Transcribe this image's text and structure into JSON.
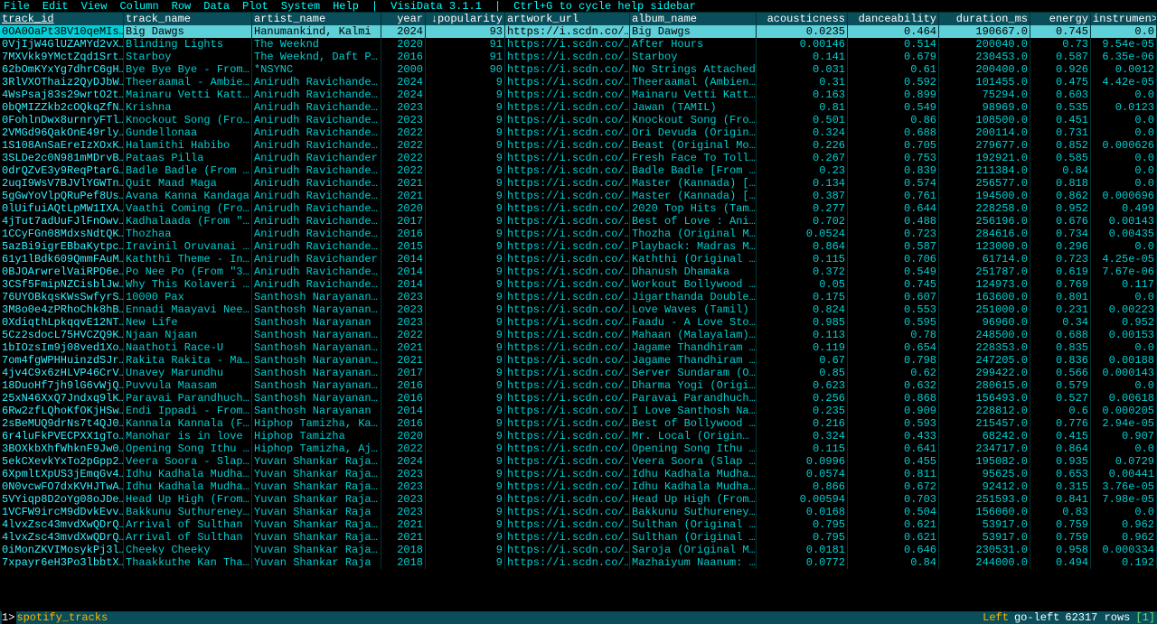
{
  "menu": [
    "File",
    "Edit",
    "View",
    "Column",
    "Row",
    "Data",
    "Plot",
    "System",
    "Help"
  ],
  "menuInfo1": "VisiData 3.1.1",
  "menuInfo2": "Ctrl+G to cycle help sidebar",
  "columns": [
    {
      "label": "track_id",
      "align": "left",
      "key": true
    },
    {
      "label": "track_name",
      "align": "left"
    },
    {
      "label": "artist_name",
      "align": "left"
    },
    {
      "label": "year",
      "align": "right"
    },
    {
      "label": "↓popularity",
      "align": "right"
    },
    {
      "label": "artwork_url",
      "align": "left"
    },
    {
      "label": "album_name",
      "align": "left"
    },
    {
      "label": "acousticness",
      "align": "right"
    },
    {
      "label": "danceability",
      "align": "right"
    },
    {
      "label": "duration_ms",
      "align": "right"
    },
    {
      "label": "energy",
      "align": "right"
    },
    {
      "label": "instrumen>",
      "align": "right"
    }
  ],
  "rows": [
    [
      "0OA0OaPt3BV10qeMIs…",
      "Big Dawgs",
      "Hanumankind, Kalmi",
      "2024",
      "93",
      "https://i.scdn.co/…",
      "Big Dawgs",
      "0.0235",
      "0.464",
      "190667.0",
      "0.745",
      "0.0"
    ],
    [
      "0VjIjW4GlUZAMYd2vX…",
      "Blinding Lights",
      "The Weeknd",
      "2020",
      "91",
      "https://i.scdn.co/…",
      "After Hours",
      "0.00146",
      "0.514",
      "200040.0",
      "0.73",
      "9.54e-05"
    ],
    [
      "7MXVkk9YMctZqd1Srt…",
      "Starboy",
      "The Weeknd, Daft P…",
      "2016",
      "91",
      "https://i.scdn.co/…",
      "Starboy",
      "0.141",
      "0.679",
      "230453.0",
      "0.587",
      "6.35e-06"
    ],
    [
      "62bOmKYxYg7dhrC6gH…",
      "Bye Bye Bye - From…",
      "*NSYNC",
      "2000",
      "90",
      "https://i.scdn.co/…",
      "No Strings Attached",
      "0.031",
      "0.61",
      "200400.0",
      "0.926",
      "0.0012"
    ],
    [
      "3RlVXOThaiz2QyDJbW…",
      "Theeraamal - Ambie…",
      "Anirudh Ravichande…",
      "2024",
      "9",
      "https://i.scdn.co/…",
      "Theeraamal (Ambien…",
      "0.31",
      "0.592",
      "101455.0",
      "0.475",
      "4.42e-05"
    ],
    [
      "4WsPsaj83s29wrtO2t…",
      "Mainaru Vetti Katt…",
      "Anirudh Ravichande…",
      "2024",
      "9",
      "https://i.scdn.co/…",
      "Mainaru Vetti Katt…",
      "0.163",
      "0.899",
      "75294.0",
      "0.603",
      "0.0"
    ],
    [
      "0bQMIZZkb2cOQkqZfN…",
      "Krishna",
      "Anirudh Ravichande…",
      "2023",
      "9",
      "https://i.scdn.co/…",
      "Jawan (TAMIL)",
      "0.81",
      "0.549",
      "98969.0",
      "0.535",
      "0.0123"
    ],
    [
      "0FohlnDwx8urnryFTl…",
      "Knockout Song (Fro…",
      "Anirudh Ravichande…",
      "2023",
      "9",
      "https://i.scdn.co/…",
      "Knockout Song (Fro…",
      "0.501",
      "0.86",
      "108500.0",
      "0.451",
      "0.0"
    ],
    [
      "2VMGd96QakOnE49rly…",
      "Gundellonaa",
      "Anirudh Ravichande…",
      "2022",
      "9",
      "https://i.scdn.co/…",
      "Ori Devuda (Origin…",
      "0.324",
      "0.688",
      "200114.0",
      "0.731",
      "0.0"
    ],
    [
      "1S108AnSaEreIzXOxK…",
      "Halamithi Habibo",
      "Anirudh Ravichande…",
      "2022",
      "9",
      "https://i.scdn.co/…",
      "Beast (Original Mo…",
      "0.226",
      "0.705",
      "279677.0",
      "0.852",
      "0.000626"
    ],
    [
      "3SLDe2c0N981mMDrvB…",
      "Pataas Pilla",
      "Anirudh Ravichander",
      "2022",
      "9",
      "https://i.scdn.co/…",
      "Fresh Face To Toll…",
      "0.267",
      "0.753",
      "192921.0",
      "0.585",
      "0.0"
    ],
    [
      "0drQZvE3y9ReqPtarG…",
      "Badle Badle (From …",
      "Anirudh Ravichande…",
      "2022",
      "9",
      "https://i.scdn.co/…",
      "Badle Badle [From …",
      "0.23",
      "0.839",
      "211384.0",
      "0.84",
      "0.0"
    ],
    [
      "2uqI9WsV7BJVlYGWTn…",
      "Quit Maad Maga",
      "Anirudh Ravichande…",
      "2021",
      "9",
      "https://i.scdn.co/…",
      "Master (Kannada) […",
      "0.134",
      "0.574",
      "256577.0",
      "0.818",
      "0.0"
    ],
    [
      "5gGwYoVlpQRuPef8Us…",
      "Avana Kanna Kandaga",
      "Anirudh Ravichande…",
      "2021",
      "9",
      "https://i.scdn.co/…",
      "Master (Kannada) […",
      "0.387",
      "0.761",
      "194500.0",
      "0.862",
      "0.000696"
    ],
    [
      "0lUifuiAQtLpMW1IXA…",
      "Vaathi Coming (Fro…",
      "Anirudh Ravichande…",
      "2020",
      "9",
      "https://i.scdn.co/…",
      "2020 Top Hits (Tam…",
      "0.277",
      "0.644",
      "228258.0",
      "0.952",
      "0.499"
    ],
    [
      "4jTut7adUuFJlFnOwv…",
      "Kadhalaada (From \"…",
      "Anirudh Ravichande…",
      "2017",
      "9",
      "https://i.scdn.co/…",
      "Best of Love : Ani…",
      "0.702",
      "0.488",
      "256196.0",
      "0.676",
      "0.00143"
    ],
    [
      "1CCyFGn08MdxsNdtQK…",
      "Thozhaa",
      "Anirudh Ravichande…",
      "2016",
      "9",
      "https://i.scdn.co/…",
      "Thozha (Original M…",
      "0.0524",
      "0.723",
      "284616.0",
      "0.734",
      "0.00435"
    ],
    [
      "5azBi9igrEBbaKytpc…",
      "Iravinil Oruvanai …",
      "Anirudh Ravichande…",
      "2015",
      "9",
      "https://i.scdn.co/…",
      "Playback: Madras M…",
      "0.864",
      "0.587",
      "123000.0",
      "0.296",
      "0.0"
    ],
    [
      "61y1lBdk609QmmFAuM…",
      "Kaththi Theme - In…",
      "Anirudh Ravichander",
      "2014",
      "9",
      "https://i.scdn.co/…",
      "Kaththi (Original …",
      "0.115",
      "0.706",
      "61714.0",
      "0.723",
      "4.25e-05"
    ],
    [
      "0BJOArwrelVaiRPD6e…",
      "Po Nee Po (From \"3…",
      "Anirudh Ravichande…",
      "2014",
      "9",
      "https://i.scdn.co/…",
      "Dhanush Dhamaka",
      "0.372",
      "0.549",
      "251787.0",
      "0.619",
      "7.67e-06"
    ],
    [
      "3CSf5FmipNZCisblJw…",
      "Why This Kolaveri …",
      "Anirudh Ravichande…",
      "2014",
      "9",
      "https://i.scdn.co/…",
      "Workout Bollywood …",
      "0.05",
      "0.745",
      "124973.0",
      "0.769",
      "0.117"
    ],
    [
      "76UYOBkqsKWsSwfyrS…",
      "10000 Pax",
      "Santhosh Narayanan…",
      "2023",
      "9",
      "https://i.scdn.co/…",
      "Jigarthanda Double…",
      "0.175",
      "0.607",
      "163600.0",
      "0.801",
      "0.0"
    ],
    [
      "3M8o0e4zPRhoChk8hB…",
      "Ennadi Maayavi Nee…",
      "Santhosh Narayanan…",
      "2023",
      "9",
      "https://i.scdn.co/…",
      "Love Waves (Tamil)",
      "0.824",
      "0.553",
      "251000.0",
      "0.231",
      "0.00223"
    ],
    [
      "0XdiqthLpkqqvE12NT…",
      "New Life",
      "Santhosh Narayanan",
      "2023",
      "9",
      "https://i.scdn.co/…",
      "Faadu - A Love Sto…",
      "0.985",
      "0.595",
      "96960.0",
      "0.34",
      "0.952"
    ],
    [
      "5Cz2sdocL75HVCZQ9K…",
      "Njaan Njaan",
      "Santhosh Narayanan…",
      "2022",
      "9",
      "https://i.scdn.co/…",
      "Mahaan (Malayalam)…",
      "0.113",
      "0.78",
      "248500.0",
      "0.688",
      "0.00153"
    ],
    [
      "1bIOzsIm9j08ved1Xo…",
      "Naathoti Race-U",
      "Santhosh Narayanan…",
      "2021",
      "9",
      "https://i.scdn.co/…",
      "Jagame Thandhiram …",
      "0.119",
      "0.654",
      "228353.0",
      "0.835",
      "0.0"
    ],
    [
      "7om4fgWPHHuinzdSJr…",
      "Rakita Rakita - Ma…",
      "Santhosh Narayanan…",
      "2021",
      "9",
      "https://i.scdn.co/…",
      "Jagame Thandhiram …",
      "0.67",
      "0.798",
      "247205.0",
      "0.836",
      "0.00188"
    ],
    [
      "4jv4C9x6zHLVP46CrV…",
      "Unavey Marundhu",
      "Santhosh Narayanan…",
      "2017",
      "9",
      "https://i.scdn.co/…",
      "Server Sundaram (O…",
      "0.85",
      "0.62",
      "299422.0",
      "0.566",
      "0.000143"
    ],
    [
      "18DuoHf7jh9lG6vWjQ…",
      "Puvvula Maasam",
      "Santhosh Narayanan…",
      "2016",
      "9",
      "https://i.scdn.co/…",
      "Dharma Yogi (Origi…",
      "0.623",
      "0.632",
      "280615.0",
      "0.579",
      "0.0"
    ],
    [
      "25xN46XxQ7Jndxq9lK…",
      "Paravai Parandhuch…",
      "Santhosh Narayanan…",
      "2016",
      "9",
      "https://i.scdn.co/…",
      "Paravai Parandhuch…",
      "0.256",
      "0.868",
      "156493.0",
      "0.527",
      "0.00618"
    ],
    [
      "6Rw2zfLQhoKfOKjHSw…",
      "Endi Ippadi - From…",
      "Santhosh Narayanan",
      "2014",
      "9",
      "https://i.scdn.co/…",
      "I Love Santhosh Na…",
      "0.235",
      "0.909",
      "228812.0",
      "0.6",
      "0.000205"
    ],
    [
      "2sBeMUQ9drNs7t4QJ0…",
      "Kannala Kannala (F…",
      "Hiphop Tamizha, Ka…",
      "2016",
      "9",
      "https://i.scdn.co/…",
      "Best of Bollywood …",
      "0.216",
      "0.593",
      "215457.0",
      "0.776",
      "2.94e-05"
    ],
    [
      "6r4luFkPVECPXX1gTo…",
      "Manohar is in love",
      "Hiphop Tamizha",
      "2020",
      "9",
      "https://i.scdn.co/…",
      "Mr. Local (Origin…",
      "0.324",
      "0.433",
      "68242.0",
      "0.415",
      "0.907"
    ],
    [
      "3BOXkbXhfWhknF9Jw0…",
      "Opening Song Ithu …",
      "Hiphop Tamizha, Aj…",
      "2022",
      "9",
      "https://i.scdn.co/…",
      "Opening Song Ithu …",
      "0.115",
      "0.641",
      "234717.0",
      "0.864",
      "0.0"
    ],
    [
      "5ekCXevkYxTo2pGpp2…",
      "Veera Soora - Slap…",
      "Yuvan Shankar Raja…",
      "2024",
      "9",
      "https://i.scdn.co/…",
      "Veera Soora (Slap …",
      "0.0996",
      "0.455",
      "195082.0",
      "0.935",
      "0.0729"
    ],
    [
      "6XpmltXpUS3jEmqGv4…",
      "Idhu Kadhala Mudha…",
      "Yuvan Shankar Raja…",
      "2023",
      "9",
      "https://i.scdn.co/…",
      "Idhu Kadhala Mudha…",
      "0.0574",
      "0.811",
      "95625.0",
      "0.653",
      "0.00441"
    ],
    [
      "0N0vcwFO7dxKVHJTwA…",
      "Idhu Kadhala Mudha…",
      "Yuvan Shankar Raja…",
      "2023",
      "9",
      "https://i.scdn.co/…",
      "Idhu Kadhala Mudha…",
      "0.866",
      "0.672",
      "92412.0",
      "0.315",
      "3.76e-05"
    ],
    [
      "5VYiqp8D2oYg08oJDe…",
      "Head Up High (From…",
      "Yuvan Shankar Raja…",
      "2023",
      "9",
      "https://i.scdn.co/…",
      "Head Up High (From…",
      "0.00594",
      "0.703",
      "251593.0",
      "0.841",
      "7.98e-05"
    ],
    [
      "1VCFW9ircM9dDvkEvv…",
      "Bakkunu Suthureney…",
      "Yuvan Shankar Raja",
      "2023",
      "9",
      "https://i.scdn.co/…",
      "Bakkunu Suthureney…",
      "0.0168",
      "0.504",
      "156060.0",
      "0.83",
      "0.0"
    ],
    [
      "4lvxZsc43mvdXwQDrQ…",
      "Arrival of Sulthan",
      "Yuvan Shankar Raja…",
      "2021",
      "9",
      "https://i.scdn.co/…",
      "Sulthan (Original …",
      "0.795",
      "0.621",
      "53917.0",
      "0.759",
      "0.962"
    ],
    [
      "4lvxZsc43mvdXwQDrQ…",
      "Arrival of Sulthan",
      "Yuvan Shankar Raja…",
      "2021",
      "9",
      "https://i.scdn.co/…",
      "Sulthan (Original …",
      "0.795",
      "0.621",
      "53917.0",
      "0.759",
      "0.962"
    ],
    [
      "0iMonZKVIMosykPj3l…",
      "Cheeky Cheeky",
      "Yuvan Shankar Raja…",
      "2018",
      "9",
      "https://i.scdn.co/…",
      "Saroja (Original M…",
      "0.0181",
      "0.646",
      "230531.0",
      "0.958",
      "0.000334"
    ],
    [
      "7xpayr6eH3Po3lbbtX…",
      "Thaakkuthe Kan Tha…",
      "Yuvan Shankar Raja",
      "2018",
      "9",
      "https://i.scdn.co/…",
      "Mazhaiyum Naanum: …",
      "0.0772",
      "0.84",
      "244000.0",
      "0.494",
      "0.192"
    ]
  ],
  "status": {
    "sheet": "spotify_tracks",
    "hint1": "Left",
    "hint2": "go-left",
    "rows": "62317 rows",
    "sel": "[1]"
  }
}
